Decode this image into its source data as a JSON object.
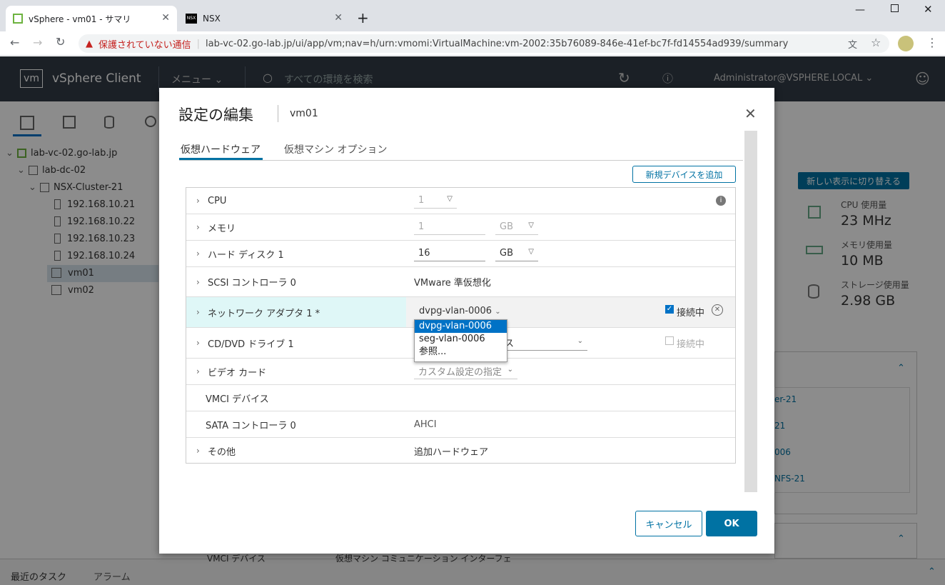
{
  "browser": {
    "tabs": [
      {
        "title": "vSphere - vm01 - サマリ"
      },
      {
        "title": "NSX"
      }
    ],
    "security_warning": "保護されていない通信",
    "url": "lab-vc-02.go-lab.jp/ui/app/vm;nav=h/urn:vmomi:VirtualMachine:vm-2002:35b76089-846e-41ef-bc7f-fd14554ad939/summary"
  },
  "app": {
    "logo": "vm",
    "title": "vSphere Client",
    "menu_label": "メニュー",
    "search_placeholder": "すべての環境を検索",
    "user": "Administrator@VSPHERE.LOCAL"
  },
  "tree": [
    {
      "label": "lab-vc-02.go-lab.jp"
    },
    {
      "label": "lab-dc-02"
    },
    {
      "label": "NSX-Cluster-21"
    },
    {
      "label": "192.168.10.21"
    },
    {
      "label": "192.168.10.22"
    },
    {
      "label": "192.168.10.23"
    },
    {
      "label": "192.168.10.24"
    },
    {
      "label": "vm01"
    },
    {
      "label": "vm02"
    }
  ],
  "right_panel": {
    "switch_button": "新しい表示に切り替える",
    "stats": [
      {
        "label": "CPU 使用量",
        "value": "23 MHz"
      },
      {
        "label": "メモリ使用量",
        "value": "10 MB"
      },
      {
        "label": "ストレージ使用量",
        "value": "2.98 GB"
      }
    ],
    "list_fragments": [
      "er-21",
      "21",
      "006",
      "NFS-21"
    ]
  },
  "footer": {
    "recent_tasks": "最近のタスク",
    "alarms": "アラーム",
    "bg_row_label": "VMCI デバイス",
    "bg_row_value": "仮想マシン コミュニケーション インターフェ"
  },
  "dialog": {
    "title": "設定の編集",
    "vm_name": "vm01",
    "tabs": [
      "仮想ハードウェア",
      "仮想マシン オプション"
    ],
    "add_device_button": "新規デバイスを追加",
    "rows": {
      "cpu": {
        "label": "CPU",
        "value": "1"
      },
      "memory": {
        "label": "メモリ",
        "value": "1",
        "unit": "GB"
      },
      "disk": {
        "label": "ハード ディスク 1",
        "value": "16",
        "unit": "GB"
      },
      "scsi": {
        "label": "SCSI コントローラ 0",
        "value": "VMware 準仮想化"
      },
      "network": {
        "label": "ネットワーク アダプタ 1 *",
        "value": "dvpg-vlan-0006",
        "connected_label": "接続中",
        "connected": true
      },
      "cddvd": {
        "label": "CD/DVD ドライブ 1",
        "value_fragment": "ス",
        "connected_label": "接続中",
        "connected": false
      },
      "video": {
        "label": "ビデオ カード",
        "value": "カスタム設定の指定"
      },
      "vmci": {
        "label": "VMCI デバイス"
      },
      "sata": {
        "label": "SATA コントローラ 0",
        "value": "AHCI"
      },
      "other": {
        "label": "その他",
        "value": "追加ハードウェア"
      }
    },
    "dropdown_options": [
      "dvpg-vlan-0006",
      "seg-vlan-0006",
      "参照..."
    ],
    "cancel_button": "キャンセル",
    "ok_button": "OK"
  }
}
